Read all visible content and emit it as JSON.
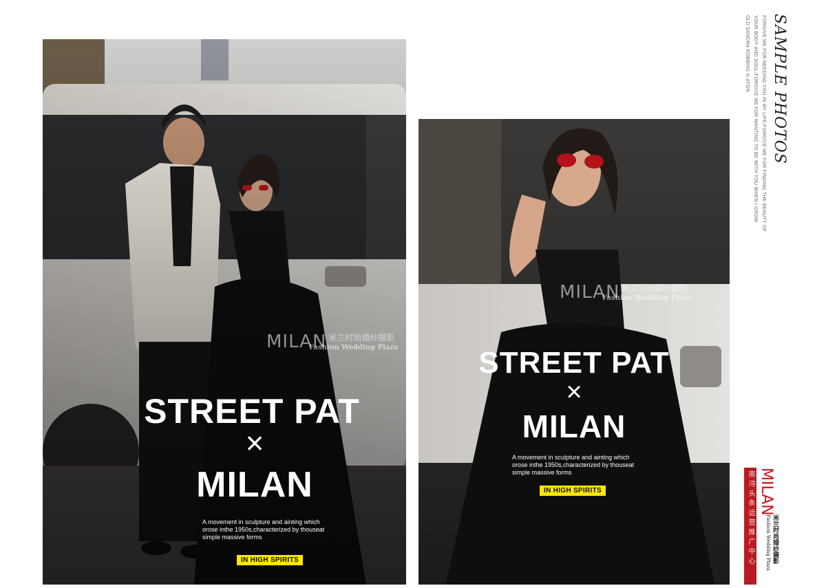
{
  "side": {
    "title": "SAMPLE PHOTOS",
    "lines": [
      "FORGIVE ME FOR NEEDING YOU IN MY LIFE;FORGIVE ME FOR FINDING THE BEAUTY OF",
      "YOUR BODY AND SOUL;FORGIVE ME FOR WANTING TO BE WITH YOU WHEN I GROW",
      "OLD SANDRA ROBBINS H·ATON"
    ]
  },
  "photo1": {
    "title": "STREET PAT",
    "cross": "×",
    "subtitle": "MILAN",
    "desc": "A movement in sculpture and ainting which\norose inthe 1950s,characterized by thouseat\nsimple massive forms",
    "tag": "IN HIGH SPIRITS",
    "watermark": {
      "brand": "MILAN",
      "cn": "米兰时尚婚纱摄影",
      "en": "Fashion Wedding Plaza"
    }
  },
  "photo2": {
    "title": "STREET PAT",
    "cross": "×",
    "subtitle": "MILAN",
    "desc": "A movement in sculpture and ainting which\norose inthe 1950s,characterized by thouseat\nsimple massive forms",
    "tag": "IN HIGH SPIRITS",
    "watermark": {
      "brand": "MILAN",
      "cn": "米兰时尚婚纱摄影",
      "en": "Fashion Wedding Plaza"
    }
  },
  "logo": {
    "brand": "MILAN",
    "cn": "米兰时尚婚纱摄影",
    "en": "Fashion Wedding Plaza",
    "seal_text": "南浔头条运营推广中心",
    "colors": {
      "red": "#c8161d",
      "seal": "#b81b22"
    }
  },
  "colors": {
    "tag": "#ffe600",
    "text": "#ffffff"
  }
}
